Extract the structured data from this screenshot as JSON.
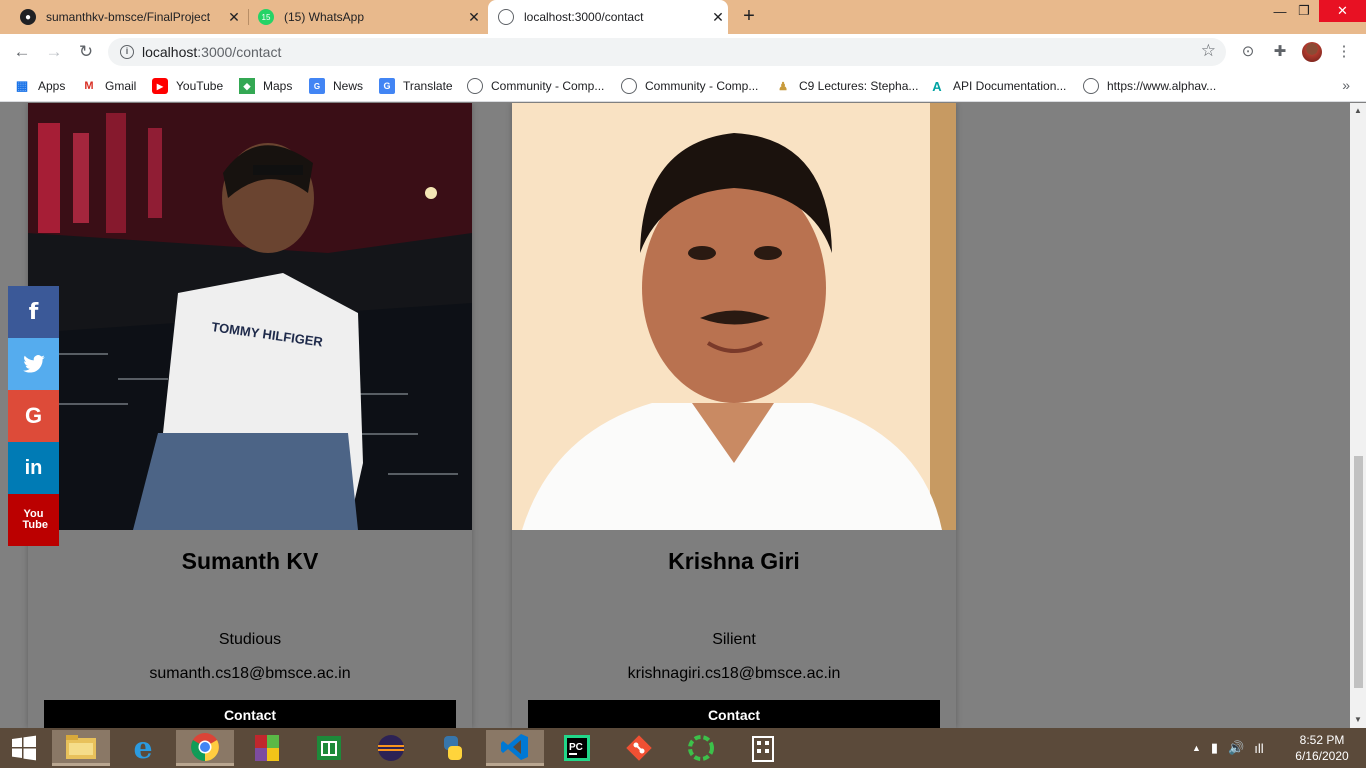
{
  "browser": {
    "tabs": [
      {
        "title": "sumanthkv-bmsce/FinalProject",
        "icon": "github-icon",
        "active": false
      },
      {
        "title": "(15) WhatsApp",
        "icon": "whatsapp-icon",
        "badge": "15",
        "active": false
      },
      {
        "title": "localhost:3000/contact",
        "icon": "globe-icon",
        "active": true
      }
    ],
    "address": {
      "host": "localhost",
      "path": ":3000/contact"
    },
    "bookmarks": [
      {
        "label": "Apps",
        "icon": "apps-grid-icon"
      },
      {
        "label": "Gmail",
        "icon": "gmail-icon"
      },
      {
        "label": "YouTube",
        "icon": "youtube-icon"
      },
      {
        "label": "Maps",
        "icon": "maps-icon"
      },
      {
        "label": "News",
        "icon": "news-icon"
      },
      {
        "label": "Translate",
        "icon": "translate-icon"
      },
      {
        "label": "Community - Comp...",
        "icon": "globe-icon"
      },
      {
        "label": "Community - Comp...",
        "icon": "globe-icon"
      },
      {
        "label": "C9 Lectures: Stepha...",
        "icon": "c9-icon"
      },
      {
        "label": "API Documentation...",
        "icon": "api-doc-icon"
      },
      {
        "label": "https://www.alphav...",
        "icon": "globe-icon"
      }
    ]
  },
  "social": [
    {
      "name": "facebook",
      "glyph": "f",
      "color": "#3b5998"
    },
    {
      "name": "twitter",
      "glyph": "🐦",
      "color": "#55acee"
    },
    {
      "name": "google",
      "glyph": "G",
      "color": "#dd4b39"
    },
    {
      "name": "linkedin",
      "glyph": "in",
      "color": "#007bb5"
    },
    {
      "name": "youtube",
      "glyph": "You Tube",
      "color": "#bb0000"
    }
  ],
  "team": [
    {
      "name": "Sumanth KV",
      "trait": "Studious",
      "email": "sumanth.cs18@bmsce.ac.in",
      "button": "Contact"
    },
    {
      "name": "Krishna Giri",
      "trait": "Silient",
      "email": "krishnagiri.cs18@bmsce.ac.in",
      "button": "Contact"
    }
  ],
  "taskbar": {
    "time": "8:52 PM",
    "date": "6/16/2020"
  }
}
